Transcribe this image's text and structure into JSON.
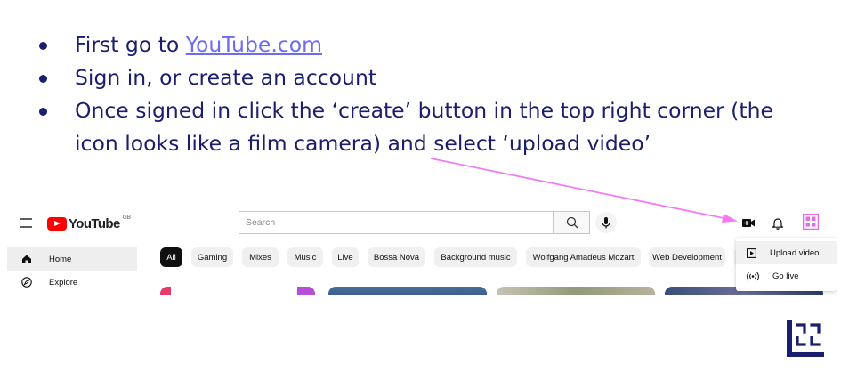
{
  "instructions": {
    "step1_prefix": "First go to ",
    "step1_link": "YouTube.com",
    "step2": "Sign in, or create an account",
    "step3": "Once signed in click the ‘create’ button in the top right corner (the icon looks like a film camera) and select ‘upload video’"
  },
  "youtube": {
    "logo_text": "YouTube",
    "country_code": "GB",
    "search_placeholder": "Search",
    "sidebar": [
      {
        "label": "Home",
        "icon": "home-icon"
      },
      {
        "label": "Explore",
        "icon": "compass-icon"
      }
    ],
    "chips": [
      "All",
      "Gaming",
      "Mixes",
      "Music",
      "Live",
      "Bossa Nova",
      "Background music",
      "Wolfgang Amadeus Mozart",
      "Web Development"
    ],
    "create_menu": [
      {
        "label": "Upload video",
        "icon": "play-square-icon"
      },
      {
        "label": "Go live",
        "icon": "broadcast-icon"
      }
    ]
  },
  "colors": {
    "instruction_text": "#1b1e6e",
    "link": "#6b6bf5",
    "arrow": "#f27bf2",
    "youtube_red": "#ff0000",
    "brand": "#1b1e6e"
  }
}
